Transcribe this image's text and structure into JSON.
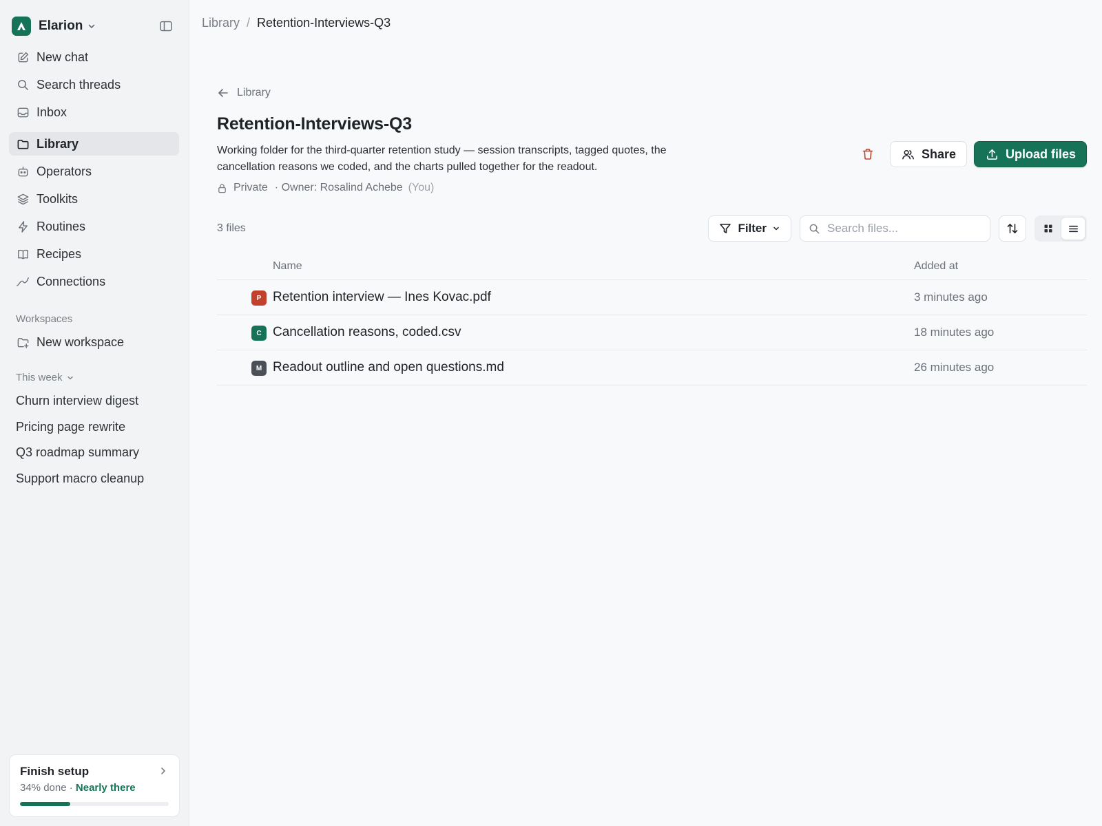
{
  "sidebar": {
    "workspace_name": "Elarion",
    "nav": [
      {
        "label": "New chat",
        "icon": "edit-icon"
      },
      {
        "label": "Search threads",
        "icon": "search-icon"
      },
      {
        "label": "Inbox",
        "icon": "inbox-icon"
      },
      {
        "label": "Library",
        "icon": "folder-icon",
        "active": true
      },
      {
        "label": "Operators",
        "icon": "bot-icon"
      },
      {
        "label": "Toolkits",
        "icon": "layers-icon"
      },
      {
        "label": "Routines",
        "icon": "bolt-icon"
      },
      {
        "label": "Recipes",
        "icon": "book-icon"
      },
      {
        "label": "Connections",
        "icon": "link-icon"
      }
    ],
    "workspaces_label": "Workspaces",
    "new_workspace_label": "New workspace",
    "this_week_label": "This week",
    "recent": [
      "Churn interview digest",
      "Pricing page rewrite",
      "Q3 roadmap summary",
      "Support macro cleanup"
    ],
    "setup": {
      "title": "Finish setup",
      "progress_text": "34% done",
      "separator": " · ",
      "status": "Nearly there",
      "progress": 0.34
    }
  },
  "breadcrumb": {
    "root": "Library",
    "separator": "/",
    "current": "Retention-Interviews-Q3"
  },
  "folder": {
    "back_label": "Library",
    "title": "Retention-Interviews-Q3",
    "description": "Working folder for the third-quarter retention study — session transcripts, tagged quotes, the cancellation reasons we coded, and the charts pulled together for the readout.",
    "visibility": "Private",
    "owner": "· Owner: Rosalind Achebe",
    "owner_suffix": "(You)"
  },
  "actions": {
    "share_label": "Share",
    "upload_label": "Upload files"
  },
  "toolbar": {
    "file_count": "3 files",
    "filter_label": "Filter",
    "search_placeholder": "Search files..."
  },
  "table": {
    "columns": {
      "name": "Name",
      "added": "Added at"
    },
    "rows": [
      {
        "badge": "P",
        "badge_color": "#c2412d",
        "name": "Retention interview — Ines Kovac.pdf",
        "added": "3 minutes ago"
      },
      {
        "badge": "C",
        "badge_color": "#177357",
        "name": "Cancellation reasons, coded.csv",
        "added": "18 minutes ago"
      },
      {
        "badge": "M",
        "badge_color": "#4b5058",
        "name": "Readout outline and open questions.md",
        "added": "26 minutes ago"
      }
    ]
  },
  "colors": {
    "accent": "#177357",
    "danger": "#c2412d"
  }
}
